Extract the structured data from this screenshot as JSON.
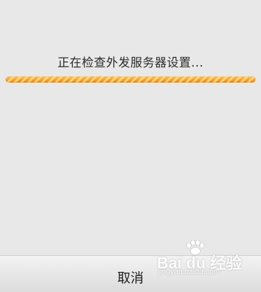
{
  "dialog": {
    "status_message": "正在检查外发服务器设置...",
    "progress_state": "indeterminate",
    "progress_color": "#f29a1f"
  },
  "footer": {
    "cancel_label": "取消"
  },
  "watermark": {
    "logo_text": "Bai du 经验",
    "url_text": "jingyan.baidu.com",
    "icon": "paw-icon"
  }
}
